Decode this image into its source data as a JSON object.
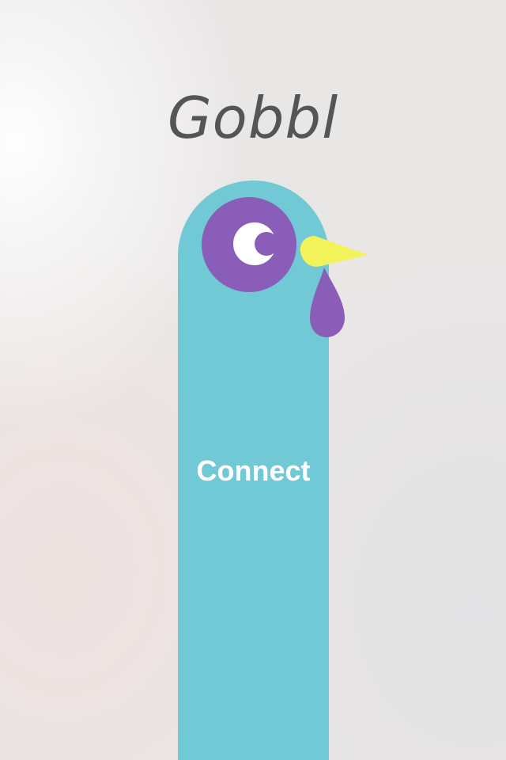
{
  "app": {
    "title": "Gobbl"
  },
  "mascot": {
    "icon": "turkey-mascot",
    "colors": {
      "body": "#72c9d6",
      "eye": "#8a5eb8",
      "eye_white": "#ffffff",
      "beak": "#f2f25a",
      "wattle": "#8a5eb8"
    }
  },
  "actions": {
    "connect_label": "Connect"
  }
}
